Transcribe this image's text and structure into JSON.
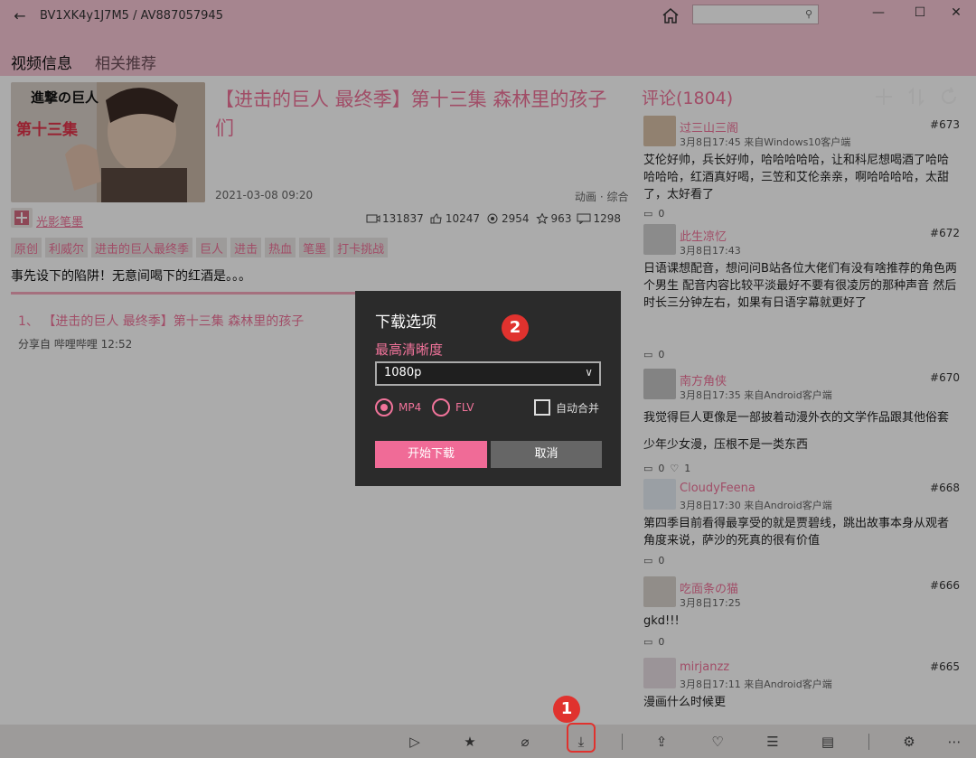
{
  "window": {
    "title": "BV1XK4y1J7M5 / AV887057945",
    "search_placeholder": ""
  },
  "tabs": [
    {
      "label": "视频信息"
    },
    {
      "label": "相关推荐"
    }
  ],
  "video": {
    "title": "【进击的巨人 最终季】第十三集 森林里的孩子们",
    "date": "2021-03-08 09:20",
    "category": "动画 · 综合",
    "thumb_text": "第十三集",
    "thumb_logo": "進撃の巨人",
    "uploader": "光影笔墨",
    "stats": {
      "views": "131837",
      "likes": "10247",
      "coins": "2954",
      "favorites": "963",
      "comments": "1298"
    },
    "tags": [
      "原创",
      "利威尔",
      "进击的巨人最终季",
      "巨人",
      "进击",
      "热血",
      "笔墨",
      "打卡挑战"
    ],
    "description": "事先设下的陷阱！无意间喝下的红酒是。。。",
    "part_title": "1、 【进击的巨人 最终季】第十三集 森林里的孩子",
    "part_sub": "分享自 哔哩哔哩 12:52"
  },
  "comments": {
    "header": "评论(1804)",
    "items": [
      {
        "name": "过三山三阁",
        "floor": "#673",
        "meta": "3月8日17:45 来自Windows10客户端",
        "text": "艾伦好帅，兵长好帅，哈哈哈哈哈，让和科尼想喝酒了哈哈哈哈哈，红酒真好喝，三笠和艾伦亲亲，啊哈哈哈哈，太甜了，太好看了",
        "replies": "0",
        "likes": ""
      },
      {
        "name": "此生凉忆",
        "floor": "#672",
        "meta": "3月8日17:43",
        "text": "日语课想配音，想问问B站各位大佬们有没有啥推荐的角色两个男生 配音内容比较平淡最好不要有很凌厉的那种声音     然后时长三分钟左右，如果有日语字幕就更好了",
        "replies": "0",
        "likes": ""
      },
      {
        "name": "南方角侠",
        "floor": "#670",
        "meta": "3月8日17:35 来自Android客户端",
        "text": "我觉得巨人更像是一部披着动漫外衣的文学作品跟其他俗套少年少女漫，压根不是一类东西",
        "replies": "0",
        "likes": "1"
      },
      {
        "name": "CloudyFeena",
        "floor": "#668",
        "meta": "3月8日17:30 来自Android客户端",
        "text": "第四季目前看得最享受的就是贾碧线，跳出故事本身从观者角度来说，萨沙的死真的很有价值",
        "replies": "0",
        "likes": ""
      },
      {
        "name": "吃面条の猫",
        "floor": "#666",
        "meta": "3月8日17:25",
        "text": "gkd!!!",
        "replies": "0",
        "likes": ""
      },
      {
        "name": "mirjanzz",
        "floor": "#665",
        "meta": "3月8日17:11 来自Android客户端",
        "text": "漫画什么时候更",
        "replies": "0",
        "likes": ""
      }
    ]
  },
  "dialog": {
    "title": "下载选项",
    "quality_label": "最高清晰度",
    "quality_value": "1080p",
    "format_mp4": "MP4",
    "format_flv": "FLV",
    "auto_merge": "自动合并",
    "start_button": "开始下载",
    "cancel_button": "取消"
  },
  "annotations": {
    "marker1": "1",
    "marker2": "2"
  },
  "colors": {
    "accent": "#f0739a",
    "titlebar": "#f8c7d6",
    "marker": "#e0322e"
  }
}
